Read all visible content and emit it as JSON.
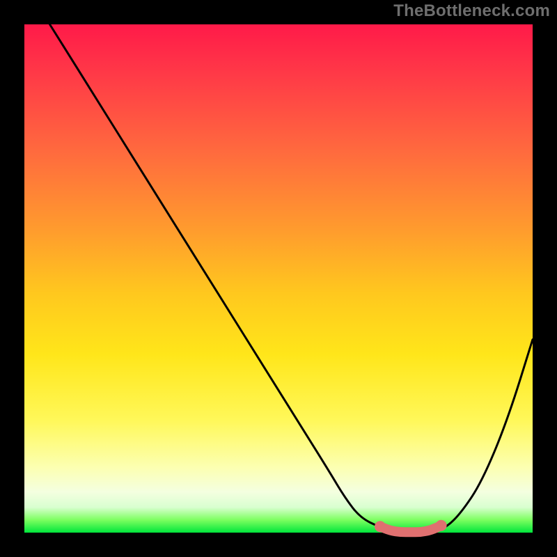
{
  "watermark": "TheBottleneck.com",
  "chart_data": {
    "type": "line",
    "title": "",
    "xlabel": "",
    "ylabel": "",
    "xlim": [
      0,
      100
    ],
    "ylim": [
      0,
      100
    ],
    "series": [
      {
        "name": "bottleneck-curve",
        "x": [
          5,
          10,
          15,
          20,
          25,
          30,
          35,
          40,
          45,
          50,
          55,
          60,
          63,
          66,
          70,
          74,
          77,
          80,
          83,
          86,
          90,
          95,
          100
        ],
        "y": [
          100,
          92,
          84,
          76,
          68,
          60,
          52,
          44,
          36,
          28,
          20,
          12,
          7,
          3,
          1,
          0,
          0,
          0,
          1,
          4,
          10,
          22,
          38
        ]
      },
      {
        "name": "optimal-band-marker",
        "x": [
          70,
          72,
          74,
          76,
          78,
          80,
          82
        ],
        "y": [
          1.2,
          0.4,
          0.1,
          0.1,
          0.1,
          0.5,
          1.4
        ]
      }
    ],
    "background_gradient": {
      "top": "#ff1a49",
      "mid_upper": "#ff9a2e",
      "mid": "#ffe61a",
      "mid_lower": "#fcffb0",
      "bottom": "#00e63b"
    }
  }
}
